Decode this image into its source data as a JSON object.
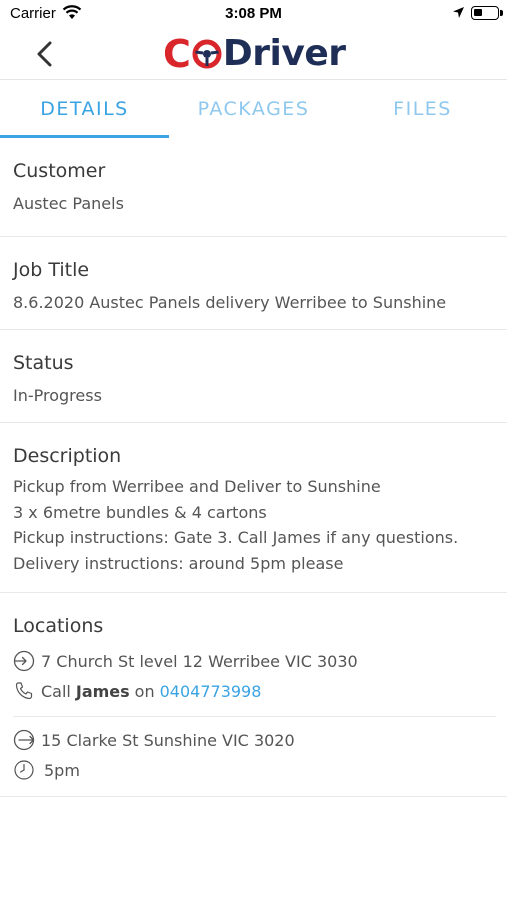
{
  "status_bar": {
    "carrier": "Carrier",
    "time": "3:08 PM"
  },
  "nav": {
    "logo_left": "C",
    "logo_right": "Driver",
    "logo_colors": {
      "red": "#d9262b",
      "navy": "#1f2e57"
    }
  },
  "tabs": [
    {
      "label": "DETAILS",
      "active": true
    },
    {
      "label": "PACKAGES",
      "active": false
    },
    {
      "label": "FILES",
      "active": false
    }
  ],
  "details": {
    "customer": {
      "title": "Customer",
      "value": "Austec Panels"
    },
    "job_title": {
      "title": "Job Title",
      "value": "8.6.2020 Austec Panels delivery Werribee to Sunshine"
    },
    "status": {
      "title": "Status",
      "value": "In-Progress"
    },
    "description": {
      "title": "Description",
      "lines": [
        "Pickup from Werribee and Deliver to Sunshine",
        "3 x 6metre bundles & 4 cartons",
        "Pickup instructions: Gate 3. Call James if any questions.",
        "Delivery instructions: around 5pm please"
      ]
    },
    "locations": {
      "title": "Locations",
      "pickup": {
        "address": "7 Church St level 12 Werribee VIC 3030",
        "call_prefix": "Call",
        "call_name": "James",
        "call_on": "on",
        "phone": "0404773998"
      },
      "delivery": {
        "address": "15 Clarke St Sunshine VIC 3020",
        "time": "5pm"
      }
    }
  },
  "colors": {
    "accent": "#3aa3e3",
    "accent_light": "#8fc8ee"
  }
}
